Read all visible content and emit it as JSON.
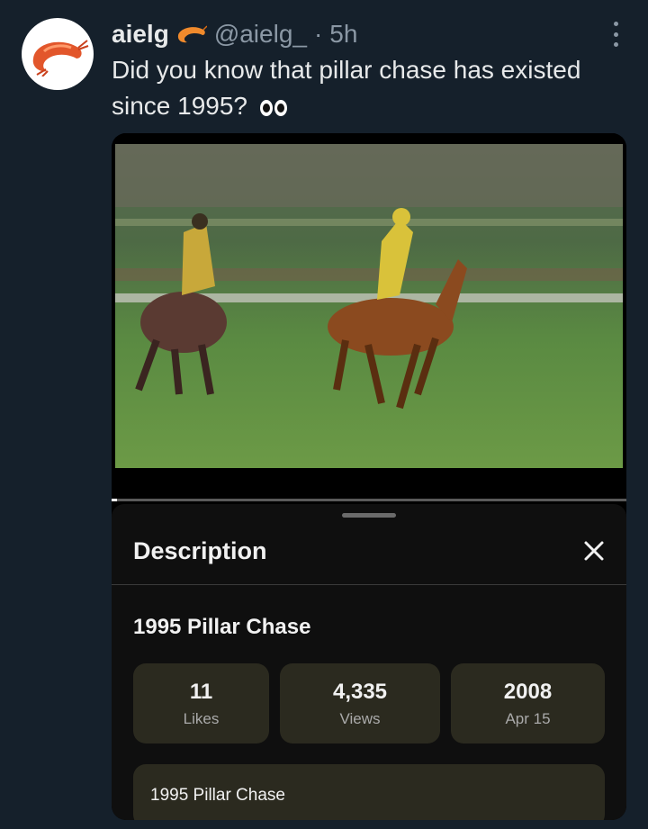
{
  "tweet": {
    "author_name": "aielg",
    "author_handle": "@aielg_",
    "separator": "·",
    "time": "5h",
    "text": "Did you know that pillar chase has existed since 1995?",
    "name_emoji_icon": "shrimp-icon",
    "text_emoji_icon": "eyes-icon",
    "avatar_icon": "shrimp-icon"
  },
  "video": {
    "progress": 0.01
  },
  "description_panel": {
    "heading": "Description",
    "video_title": "1995 Pillar Chase",
    "stats": [
      {
        "value": "11",
        "label": "Likes"
      },
      {
        "value": "4,335",
        "label": "Views"
      },
      {
        "value": "2008",
        "label": "Apr 15"
      }
    ],
    "description_text": "1995 Pillar Chase"
  },
  "colors": {
    "background": "#15202b",
    "sheet": "#0f0f0f",
    "stat_card": "#2b2a1f",
    "secondary_text": "#8b98a5"
  }
}
